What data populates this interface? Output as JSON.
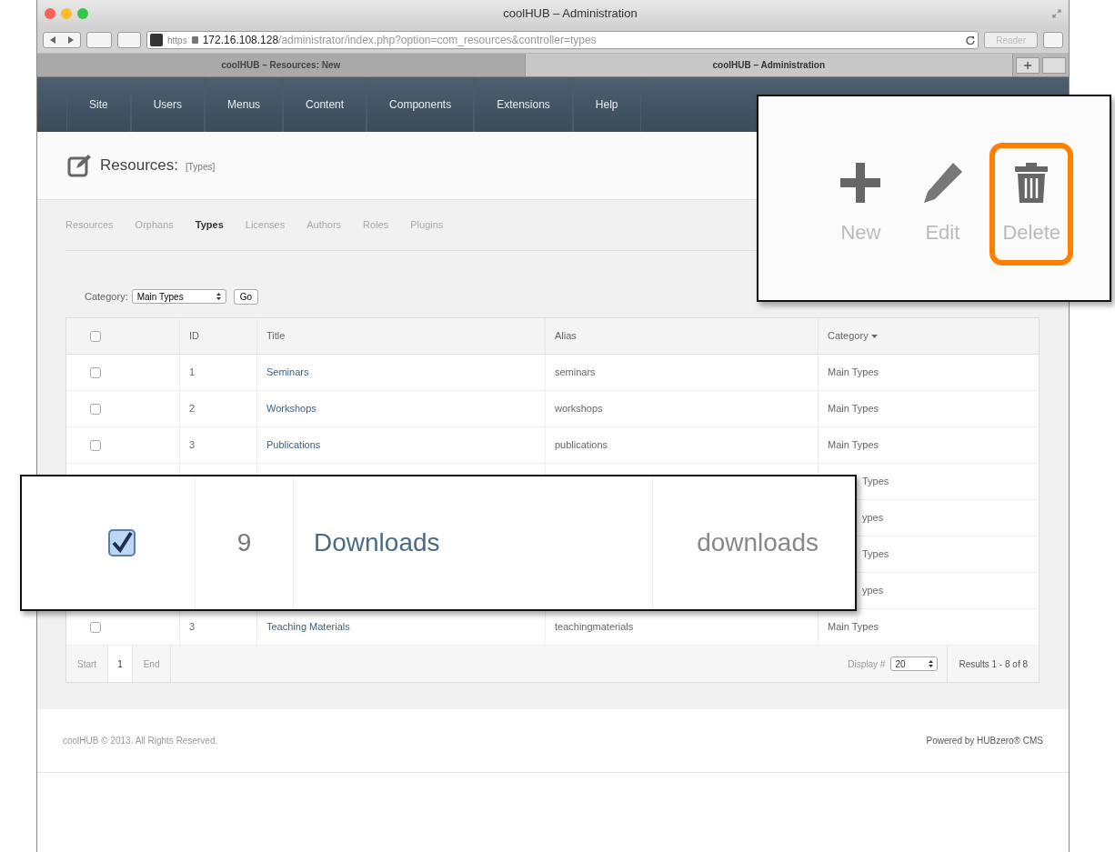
{
  "window": {
    "title": "coolHUB – Administration",
    "url_scheme": "https",
    "url_host": "172.16.108.128",
    "url_path": "/administrator/index.php?option=com_resources&controller=types",
    "reader": "Reader"
  },
  "tabs": [
    {
      "label": "coolHUB – Resources: New",
      "selected": false
    },
    {
      "label": "coolHUB – Administration",
      "selected": true
    }
  ],
  "nav": [
    "Site",
    "Users",
    "Menus",
    "Content",
    "Components",
    "Extensions",
    "Help"
  ],
  "page_title": "Resources:",
  "page_subtitle": "[Types]",
  "subtabs": [
    {
      "label": "Resources",
      "selected": false
    },
    {
      "label": "Orphans",
      "selected": false
    },
    {
      "label": "Types",
      "selected": true
    },
    {
      "label": "Licenses",
      "selected": false
    },
    {
      "label": "Authors",
      "selected": false
    },
    {
      "label": "Roles",
      "selected": false
    },
    {
      "label": "Plugins",
      "selected": false
    }
  ],
  "filter": {
    "label": "Category:",
    "value": "Main Types",
    "button": "Go"
  },
  "table": {
    "select_all_checked": false,
    "columns": [
      "ID",
      "Title",
      "Alias",
      "Category"
    ],
    "rows": [
      {
        "checked": false,
        "id": "1",
        "title": "Seminars",
        "alias": "seminars",
        "category": "Main Types"
      },
      {
        "checked": false,
        "id": "2",
        "title": "Workshops",
        "alias": "workshops",
        "category": "Main Types"
      },
      {
        "checked": false,
        "id": "3",
        "title": "Publications",
        "alias": "publications",
        "category": "Main Types"
      },
      {
        "category": "Types"
      },
      {
        "category": "ypes"
      },
      {
        "category": "Types"
      },
      {
        "category": "ypes"
      },
      {
        "checked": false,
        "id": "3",
        "title": "Teaching Materials",
        "alias": "teachingmaterials",
        "category": "Main Types"
      }
    ]
  },
  "pagination": {
    "start": "Start",
    "page": "1",
    "end": "End",
    "display_label": "Display #",
    "display_value": "20",
    "results": "Results 1 - 8 of 8"
  },
  "footer": {
    "copyright": "coolHUB © 2013. All Rights Reserved.",
    "powered": "Powered by HUBzero® CMS"
  },
  "toolbar_callout": {
    "buttons": [
      {
        "kind": "new",
        "label": "New",
        "highlighted": false
      },
      {
        "kind": "edit",
        "label": "Edit",
        "highlighted": false
      },
      {
        "kind": "delete",
        "label": "Delete",
        "highlighted": true
      }
    ]
  },
  "row_callout": {
    "checked": true,
    "id": "9",
    "title": "Downloads",
    "alias": "downloads"
  }
}
